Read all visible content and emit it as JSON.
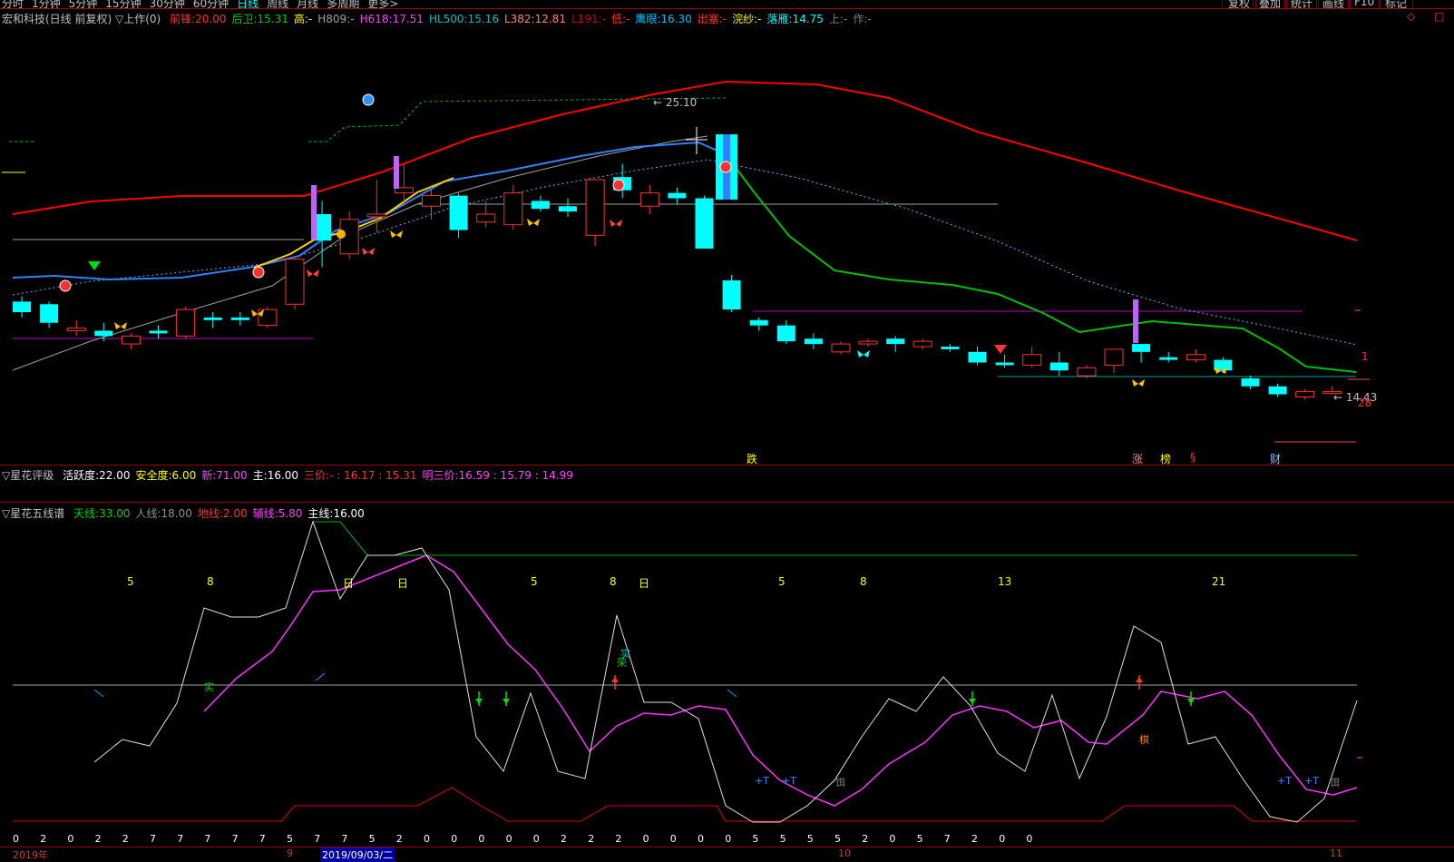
{
  "toolbar": {
    "periods": [
      "分时",
      "1分钟",
      "5分钟",
      "15分钟",
      "30分钟",
      "60分钟",
      "日线",
      "周线",
      "月线",
      "多周期",
      "更多>"
    ],
    "active_period": "日线",
    "right_buttons": [
      "复权",
      "叠加",
      "统计",
      "画线",
      "F10",
      "标记"
    ],
    "corner_icons": [
      "◇",
      "□"
    ]
  },
  "main_legend": {
    "title": "宏和科技(日线 前复权) ▽上作(0)",
    "items": [
      {
        "label": "前锋:",
        "value": "20.00",
        "color": "#ff3030"
      },
      {
        "label": "后卫:",
        "value": "15.31",
        "color": "#00d000"
      },
      {
        "label": "高:",
        "value": "-",
        "color": "#ffff00"
      },
      {
        "label": "H809:",
        "value": "-",
        "color": "#a0a0a0"
      },
      {
        "label": "H618:",
        "value": "17.51",
        "color": "#ff40ff"
      },
      {
        "label": "HL500:",
        "value": "15.16",
        "color": "#00c0c0"
      },
      {
        "label": "L382:",
        "value": "12.81",
        "color": "#ff8080"
      },
      {
        "label": "L191:",
        "value": "-",
        "color": "#d00000"
      },
      {
        "label": "低:",
        "value": "-",
        "color": "#ff3030"
      },
      {
        "label": "鹰眼:",
        "value": "16.30",
        "color": "#00c0ff"
      },
      {
        "label": "出塞:",
        "value": "-",
        "color": "#ff3030"
      },
      {
        "label": "浣纱:",
        "value": "-",
        "color": "#ffff00"
      },
      {
        "label": "落雁:",
        "value": "14.75",
        "color": "#00ffff"
      },
      {
        "label": "上:",
        "value": "-",
        "color": "#808080"
      },
      {
        "label": "作:",
        "value": "-",
        "color": "#808080"
      }
    ]
  },
  "main_chart_labels": {
    "high_price": "25.10",
    "low_price": "14.43",
    "right_one": "1",
    "right_count": "28",
    "bottom_marks": [
      "跌",
      "涨",
      "榜",
      "§",
      "财"
    ]
  },
  "rating_panel": {
    "title": "▽星花评级",
    "items": [
      {
        "label": "活跃度:",
        "value": "22.00",
        "color": "#ffffff"
      },
      {
        "label": "安全度:",
        "value": "6.00",
        "color": "#ffff00"
      },
      {
        "label": "新:",
        "value": "71.00",
        "color": "#ff40ff"
      },
      {
        "label": "主:",
        "value": "16.00",
        "color": "#ffffff"
      },
      {
        "label": "三价:",
        "value": "- : 16.17 : 15.31",
        "color": "#ff3030"
      },
      {
        "label": "明三价:",
        "value": "16.59 : 15.79 : 14.99",
        "color": "#ff40ff"
      }
    ]
  },
  "five_line_panel": {
    "title": "▽星花五线谱",
    "items": [
      {
        "label": "天线:",
        "value": "33.00",
        "color": "#00d000"
      },
      {
        "label": "人线:",
        "value": "18.00",
        "color": "#909090"
      },
      {
        "label": "地线:",
        "value": "2.00",
        "color": "#ff3030"
      },
      {
        "label": "辅线:",
        "value": "5.80",
        "color": "#ff40ff"
      },
      {
        "label": "主线:",
        "value": "16.00",
        "color": "#ffffff"
      }
    ],
    "fib_numbers": [
      "5",
      "8",
      "日",
      "日",
      "5",
      "8",
      "日",
      "5",
      "8",
      "13",
      "21"
    ],
    "chars": [
      "实",
      "实",
      "荣",
      "棋",
      "饵",
      "饵",
      "+T",
      "+T",
      "+T",
      "+T"
    ],
    "bottom_numbers": [
      "0",
      "2",
      "0",
      "2",
      "2",
      "7",
      "7",
      "7",
      "7",
      "7",
      "5",
      "7",
      "7",
      "5",
      "2",
      "0",
      "0",
      "0",
      "0",
      "0",
      "2",
      "2",
      "2",
      "0",
      "0",
      "0",
      "0",
      "5",
      "5",
      "5",
      "5",
      "2",
      "0",
      "5",
      "7",
      "2",
      "0",
      "0"
    ]
  },
  "x_axis": {
    "labels": [
      "2019年",
      "9",
      "2019/09/03/二",
      "10",
      "11"
    ]
  },
  "candles": [
    {
      "o": 17.2,
      "c": 16.8,
      "h": 17.4,
      "l": 16.6,
      "up": false
    },
    {
      "o": 16.4,
      "c": 17.1,
      "h": 17.2,
      "l": 16.2,
      "up": false
    },
    {
      "o": 16.2,
      "c": 16.1,
      "h": 16.5,
      "l": 15.9,
      "up": true
    },
    {
      "o": 16.1,
      "c": 15.9,
      "h": 16.4,
      "l": 15.7,
      "up": false
    },
    {
      "o": 15.6,
      "c": 15.9,
      "h": 16.0,
      "l": 15.4,
      "up": true
    },
    {
      "o": 16.1,
      "c": 16.0,
      "h": 16.3,
      "l": 15.8,
      "up": false
    },
    {
      "o": 15.9,
      "c": 16.9,
      "h": 17.0,
      "l": 15.8,
      "up": true
    },
    {
      "o": 16.6,
      "c": 16.5,
      "h": 16.8,
      "l": 16.2,
      "up": false
    },
    {
      "o": 16.6,
      "c": 16.5,
      "h": 16.8,
      "l": 16.3,
      "up": false
    },
    {
      "o": 16.3,
      "c": 16.9,
      "h": 17.0,
      "l": 16.2,
      "up": true
    },
    {
      "o": 17.1,
      "c": 18.8,
      "h": 18.9,
      "l": 16.9,
      "up": true
    },
    {
      "o": 19.5,
      "c": 20.5,
      "h": 21.0,
      "l": 18.5,
      "up": false
    },
    {
      "o": 19.0,
      "c": 20.3,
      "h": 20.6,
      "l": 18.8,
      "up": true
    },
    {
      "o": 20.5,
      "c": 20.4,
      "h": 21.8,
      "l": 19.8,
      "up": true
    },
    {
      "o": 21.3,
      "c": 21.5,
      "h": 22.4,
      "l": 20.8,
      "up": true
    },
    {
      "o": 20.8,
      "c": 21.2,
      "h": 21.6,
      "l": 20.3,
      "up": true
    },
    {
      "o": 21.2,
      "c": 19.9,
      "h": 21.3,
      "l": 19.6,
      "up": false
    },
    {
      "o": 20.2,
      "c": 20.5,
      "h": 21.0,
      "l": 20.0,
      "up": true
    },
    {
      "o": 20.1,
      "c": 21.3,
      "h": 21.6,
      "l": 19.9,
      "up": true
    },
    {
      "o": 21.0,
      "c": 20.7,
      "h": 21.2,
      "l": 20.6,
      "up": false
    },
    {
      "o": 20.8,
      "c": 20.6,
      "h": 21.1,
      "l": 20.4,
      "up": false
    },
    {
      "o": 19.7,
      "c": 21.8,
      "h": 21.8,
      "l": 19.3,
      "up": true
    },
    {
      "o": 21.4,
      "c": 21.9,
      "h": 22.4,
      "l": 21.1,
      "up": false
    },
    {
      "o": 20.8,
      "c": 21.3,
      "h": 21.6,
      "l": 20.5,
      "up": true
    },
    {
      "o": 21.3,
      "c": 21.1,
      "h": 21.5,
      "l": 20.9,
      "up": false
    },
    {
      "o": 21.1,
      "c": 19.2,
      "h": 21.2,
      "l": 19.2,
      "up": false
    },
    {
      "o": 18.0,
      "c": 16.9,
      "h": 18.2,
      "l": 16.8,
      "up": false
    },
    {
      "o": 16.5,
      "c": 16.3,
      "h": 16.6,
      "l": 16.1,
      "up": false
    },
    {
      "o": 16.3,
      "c": 15.7,
      "h": 16.5,
      "l": 15.6,
      "up": false
    },
    {
      "o": 15.8,
      "c": 15.6,
      "h": 16.0,
      "l": 15.4,
      "up": false
    },
    {
      "o": 15.3,
      "c": 15.6,
      "h": 15.7,
      "l": 15.2,
      "up": true
    },
    {
      "o": 15.7,
      "c": 15.6,
      "h": 15.8,
      "l": 15.5,
      "up": true
    },
    {
      "o": 15.6,
      "c": 15.8,
      "h": 15.9,
      "l": 15.3,
      "up": false
    },
    {
      "o": 15.7,
      "c": 15.5,
      "h": 15.8,
      "l": 15.4,
      "up": true
    },
    {
      "o": 15.5,
      "c": 15.4,
      "h": 15.6,
      "l": 15.3,
      "up": false
    },
    {
      "o": 15.3,
      "c": 14.9,
      "h": 15.5,
      "l": 14.8,
      "up": false
    },
    {
      "o": 14.8,
      "c": 14.9,
      "h": 15.2,
      "l": 14.7,
      "up": false
    },
    {
      "o": 14.8,
      "c": 15.2,
      "h": 15.5,
      "l": 14.7,
      "up": true
    },
    {
      "o": 14.9,
      "c": 14.6,
      "h": 15.3,
      "l": 14.4,
      "up": false
    },
    {
      "o": 14.4,
      "c": 14.7,
      "h": 14.8,
      "l": 14.3,
      "up": true
    },
    {
      "o": 14.8,
      "c": 15.4,
      "h": 15.4,
      "l": 14.5,
      "up": true
    },
    {
      "o": 15.3,
      "c": 15.6,
      "h": 15.6,
      "l": 14.9,
      "up": false
    },
    {
      "o": 15.1,
      "c": 15.0,
      "h": 15.3,
      "l": 14.9,
      "up": false
    },
    {
      "o": 15.0,
      "c": 15.2,
      "h": 15.4,
      "l": 14.9,
      "up": true
    },
    {
      "o": 15.0,
      "c": 14.6,
      "h": 15.1,
      "l": 14.5,
      "up": false
    },
    {
      "o": 14.3,
      "c": 14.0,
      "h": 14.4,
      "l": 13.9,
      "up": false
    },
    {
      "o": 14.0,
      "c": 13.7,
      "h": 14.1,
      "l": 13.6,
      "up": false
    },
    {
      "o": 13.6,
      "c": 13.8,
      "h": 13.9,
      "l": 13.5,
      "up": true
    },
    {
      "o": 13.8,
      "c": 13.8,
      "h": 14.0,
      "l": 13.7,
      "up": true
    }
  ]
}
